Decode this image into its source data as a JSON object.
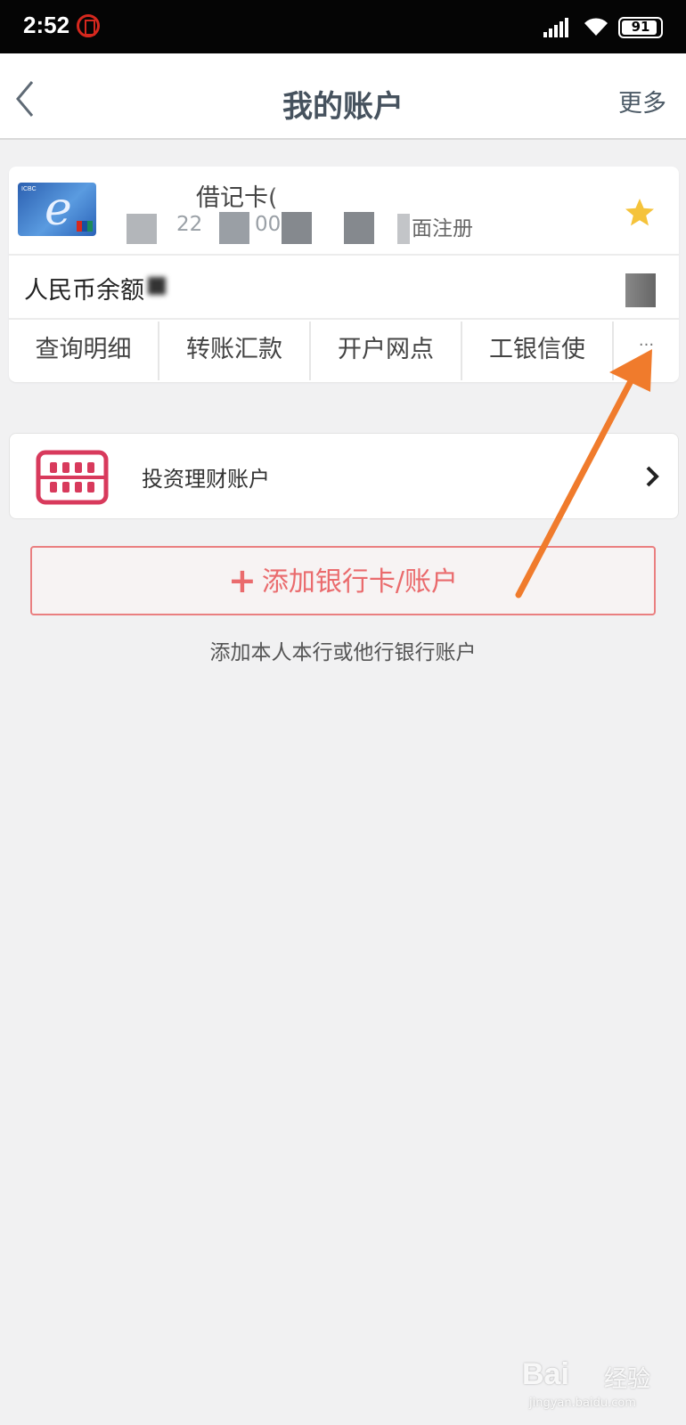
{
  "status_bar": {
    "time": "2:52",
    "battery": "91"
  },
  "header": {
    "title": "我的账户",
    "more_label": "更多"
  },
  "card": {
    "name": "借记卡(",
    "number_fragment_1": "22",
    "number_fragment_2": "00",
    "register_text": "面注册",
    "balance_label": "人民币余额",
    "actions": [
      {
        "label": "查询明细"
      },
      {
        "label": "转账汇款"
      },
      {
        "label": "开户网点"
      },
      {
        "label": "工银信使"
      },
      {
        "label": "···"
      }
    ]
  },
  "invest": {
    "label": "投资理财账户"
  },
  "add": {
    "button_label": "添加银行卡/账户",
    "plus": "+",
    "hint": "添加本人本行或他行银行账户"
  },
  "watermark": {
    "brand": "Bai",
    "brand2": "经验",
    "url": "jingyan.baidu.com"
  },
  "colors": {
    "accent": "#ea6b6d",
    "annotation_arrow": "#f07b2c",
    "star": "#f5c33b",
    "title": "#46525e"
  }
}
